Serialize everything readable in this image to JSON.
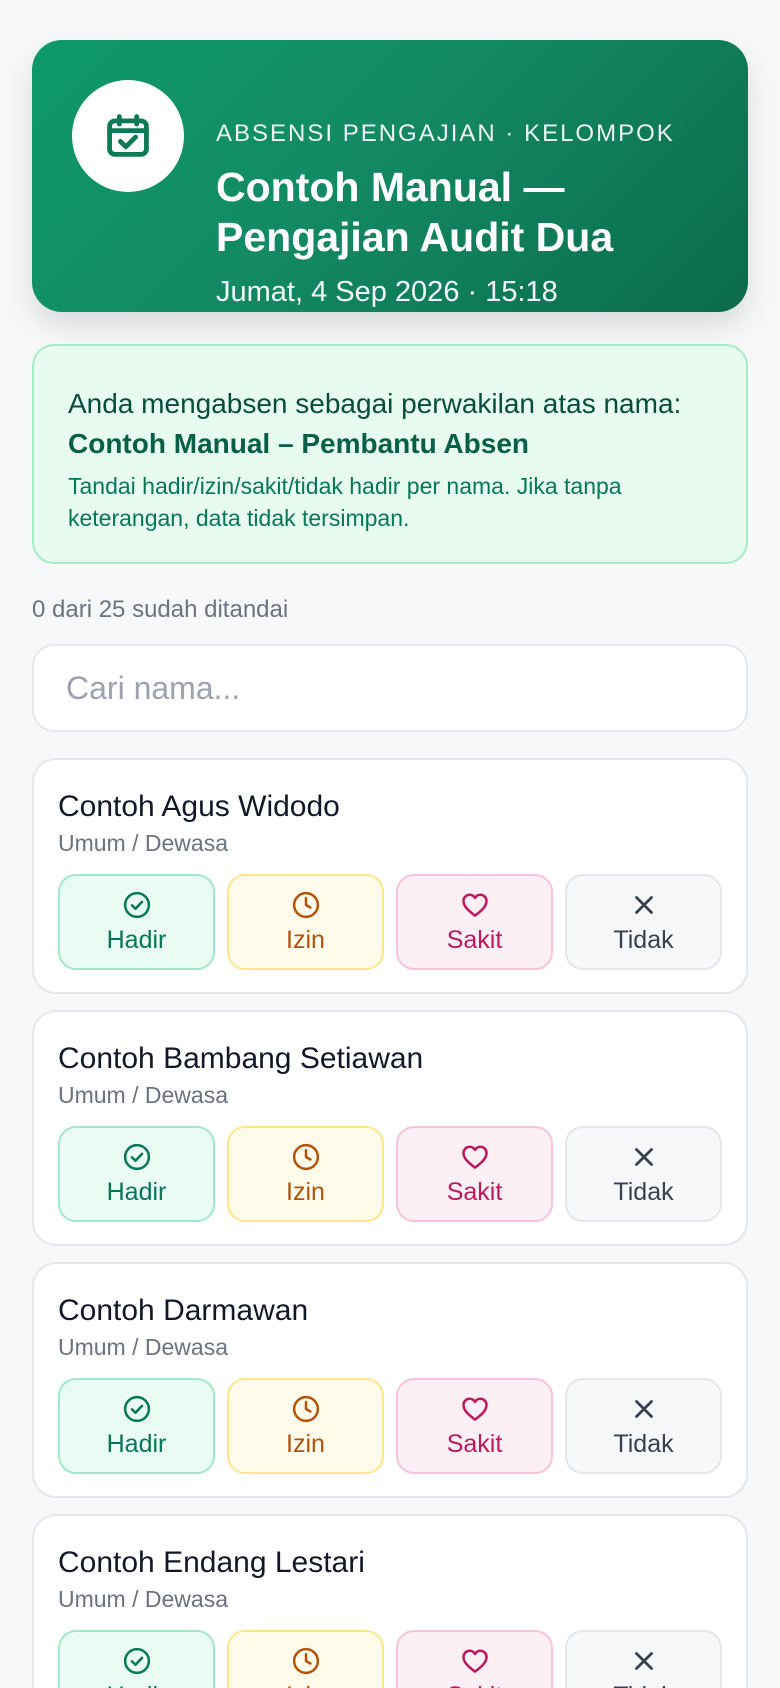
{
  "header": {
    "kicker": "ABSENSI PENGAJIAN · KELOMPOK",
    "title": "Contoh Manual — Pengajian Audit Dua",
    "date": "Jumat, 4 Sep 2026 · 15:18",
    "icon": "calendar-check-icon"
  },
  "info": {
    "line": "Anda mengabsen sebagai perwakilan atas nama:",
    "name": "Contoh Manual – Pembantu Absen",
    "note": "Tandai hadir/izin/sakit/tidak hadir per nama. Jika tanpa keterangan, data tidak tersimpan."
  },
  "progress": "0 dari 25 sudah ditandai",
  "search": {
    "placeholder": "Cari nama..."
  },
  "buttons": {
    "hadir": "Hadir",
    "izin": "Izin",
    "sakit": "Sakit",
    "tidak": "Tidak"
  },
  "people": [
    {
      "name": "Contoh Agus Widodo",
      "group": "Umum / Dewasa"
    },
    {
      "name": "Contoh Bambang Setiawan",
      "group": "Umum / Dewasa"
    },
    {
      "name": "Contoh Darmawan",
      "group": "Umum / Dewasa"
    },
    {
      "name": "Contoh Endang Lestari",
      "group": "Umum / Dewasa"
    }
  ],
  "colors": {
    "brand": "#0e9a6a",
    "hadir": "#047857",
    "izin": "#b45309",
    "sakit": "#be185d",
    "tidak": "#374151"
  }
}
